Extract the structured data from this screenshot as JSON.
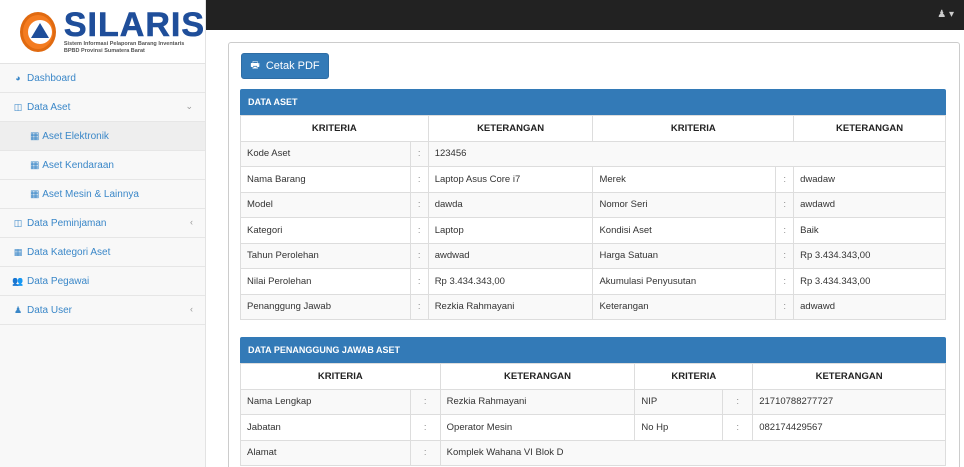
{
  "brand": {
    "title": "SILARIS",
    "subtitle_line1": "Sistem Informasi Pelaporan Barang Inventaris",
    "subtitle_line2": "BPBD Provinsi Sumatera Barat"
  },
  "sidebar": {
    "items": [
      {
        "label": "Dashboard",
        "icon": "dashboard-icon"
      },
      {
        "label": "Data Aset",
        "icon": "table-icon"
      },
      {
        "label": "Aset Elektronik",
        "icon": "grid-icon"
      },
      {
        "label": "Aset Kendaraan",
        "icon": "grid-icon"
      },
      {
        "label": "Aset Mesin & Lainnya",
        "icon": "grid-icon"
      },
      {
        "label": "Data Peminjaman",
        "icon": "table-icon"
      },
      {
        "label": "Data Kategori Aset",
        "icon": "grid-icon"
      },
      {
        "label": "Data Pegawai",
        "icon": "users-icon"
      },
      {
        "label": "Data User",
        "icon": "user-icon"
      }
    ]
  },
  "toolbar": {
    "pdf_label": "Cetak PDF"
  },
  "aset": {
    "title": "DATA ASET",
    "headers": [
      "KRITERIA",
      "KETERANGAN",
      "KRITERIA",
      "KETERANGAN"
    ],
    "sep": ":",
    "rows": [
      {
        "k1": "Kode Aset",
        "v1": "123456",
        "k2": "",
        "v2": ""
      },
      {
        "k1": "Nama Barang",
        "v1": "Laptop Asus Core i7",
        "k2": "Merek",
        "v2": "dwadaw"
      },
      {
        "k1": "Model",
        "v1": "dawda",
        "k2": "Nomor Seri",
        "v2": "awdawd"
      },
      {
        "k1": "Kategori",
        "v1": "Laptop",
        "k2": "Kondisi Aset",
        "v2": "Baik"
      },
      {
        "k1": "Tahun Perolehan",
        "v1": "awdwad",
        "k2": "Harga Satuan",
        "v2": "Rp 3.434.343,00"
      },
      {
        "k1": "Nilai Perolehan",
        "v1": "Rp 3.434.343,00",
        "k2": "Akumulasi Penyusutan",
        "v2": "Rp 3.434.343,00"
      },
      {
        "k1": "Penanggung Jawab",
        "v1": "Rezkia Rahmayani",
        "k2": "Keterangan",
        "v2": "adwawd"
      }
    ]
  },
  "pj": {
    "title": "DATA PENANGGUNG JAWAB ASET",
    "headers": [
      "KRITERIA",
      "KETERANGAN",
      "KRITERIA",
      "KETERANGAN"
    ],
    "rows": [
      {
        "k1": "Nama Lengkap",
        "v1": "Rezkia Rahmayani",
        "k2": "NIP",
        "v2": "21710788277727"
      },
      {
        "k1": "Jabatan",
        "v1": "Operator Mesin",
        "k2": "No Hp",
        "v2": "082174429567"
      },
      {
        "k1": "Alamat",
        "v1": "Komplek Wahana VI Blok D",
        "k2": "",
        "v2": ""
      }
    ]
  }
}
